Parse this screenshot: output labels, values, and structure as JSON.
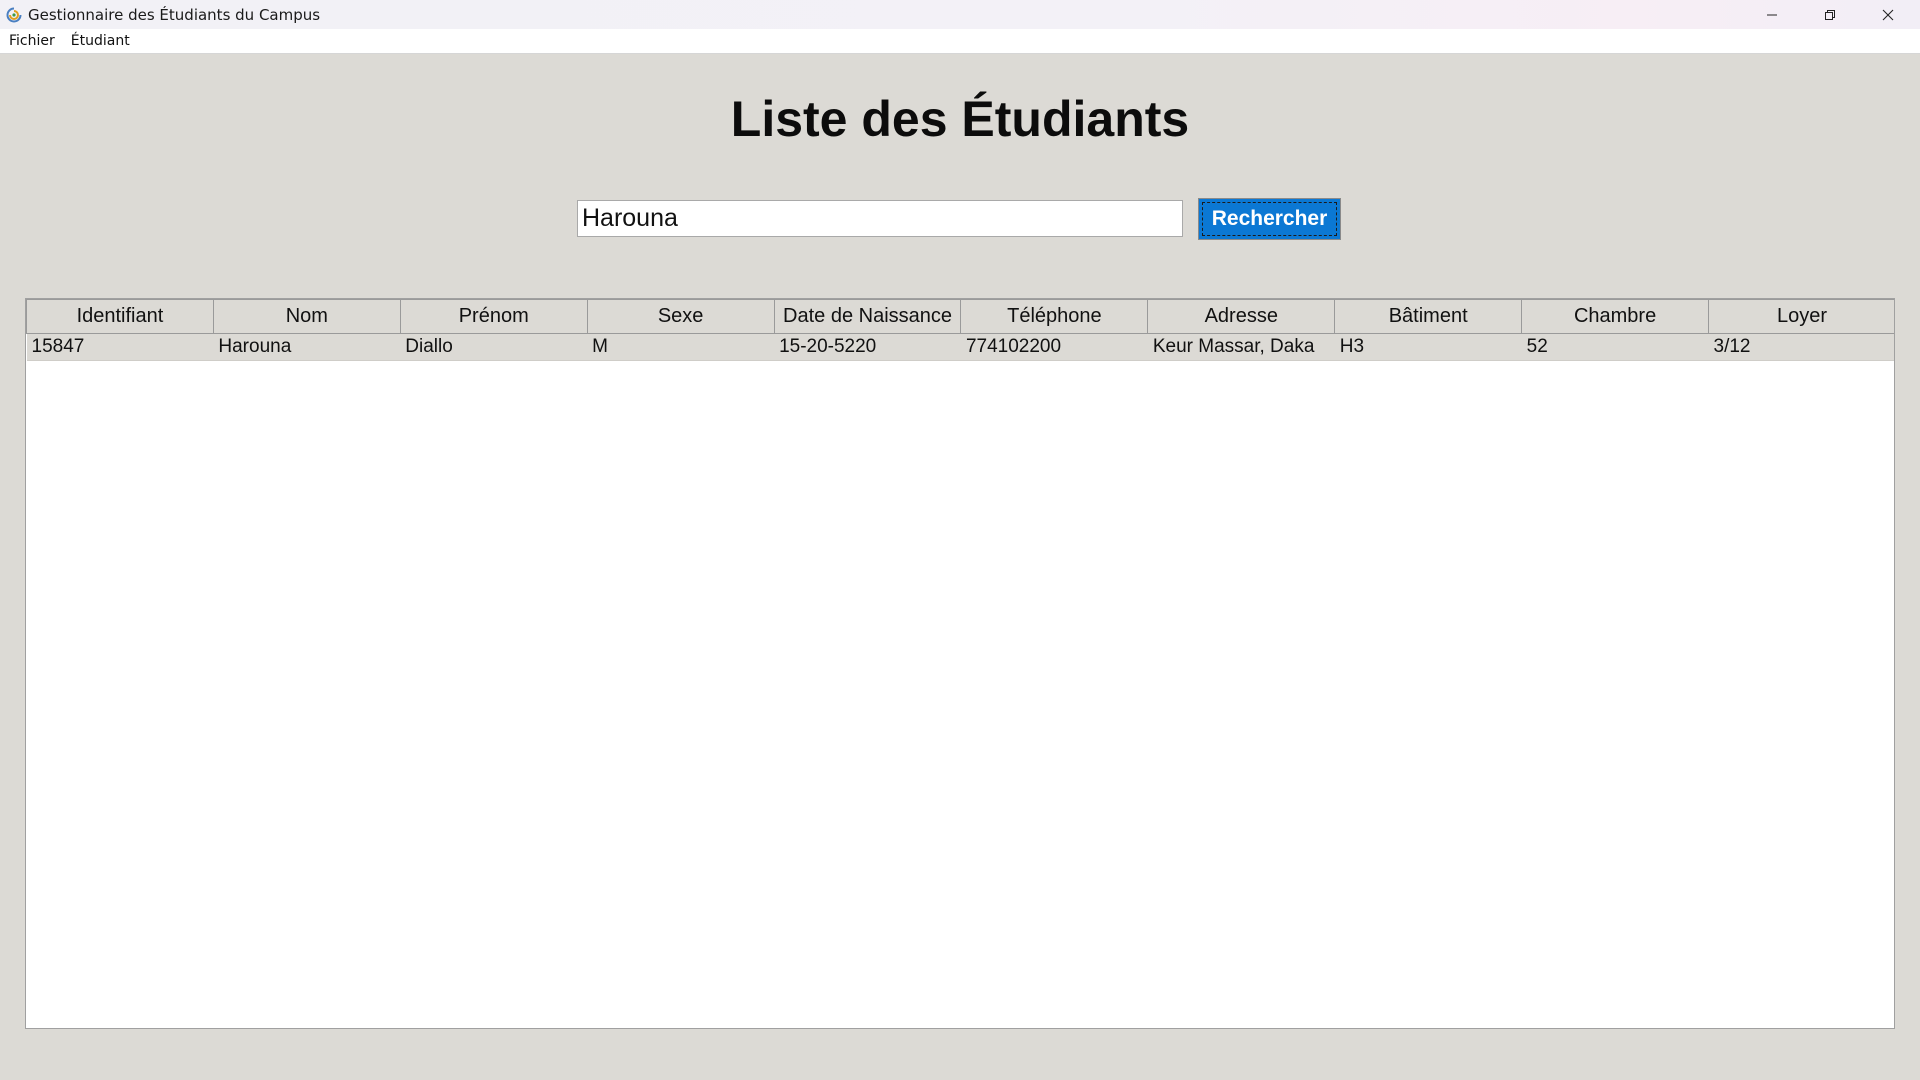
{
  "window": {
    "title": "Gestionnaire des Étudiants du Campus",
    "controls": [
      "minimize",
      "restore",
      "close"
    ]
  },
  "menubar": {
    "items": [
      "Fichier",
      "Étudiant"
    ]
  },
  "page": {
    "heading": "Liste des Étudiants"
  },
  "search": {
    "value": "Harouna",
    "button_label": "Rechercher",
    "button_color": "#0b78d4"
  },
  "table": {
    "columns": [
      "Identifiant",
      "Nom",
      "Prénom",
      "Sexe",
      "Date de Naissance",
      "Téléphone",
      "Adresse",
      "Bâtiment",
      "Chambre",
      "Loyer"
    ],
    "rows": [
      [
        "15847",
        "Harouna",
        "Diallo",
        "M",
        "15-20-5220",
        "774102200",
        "Keur Massar, Daka",
        "H3",
        "52",
        "3/12"
      ]
    ]
  },
  "colors": {
    "background": "#dcdad5",
    "accent": "#0b78d4"
  }
}
